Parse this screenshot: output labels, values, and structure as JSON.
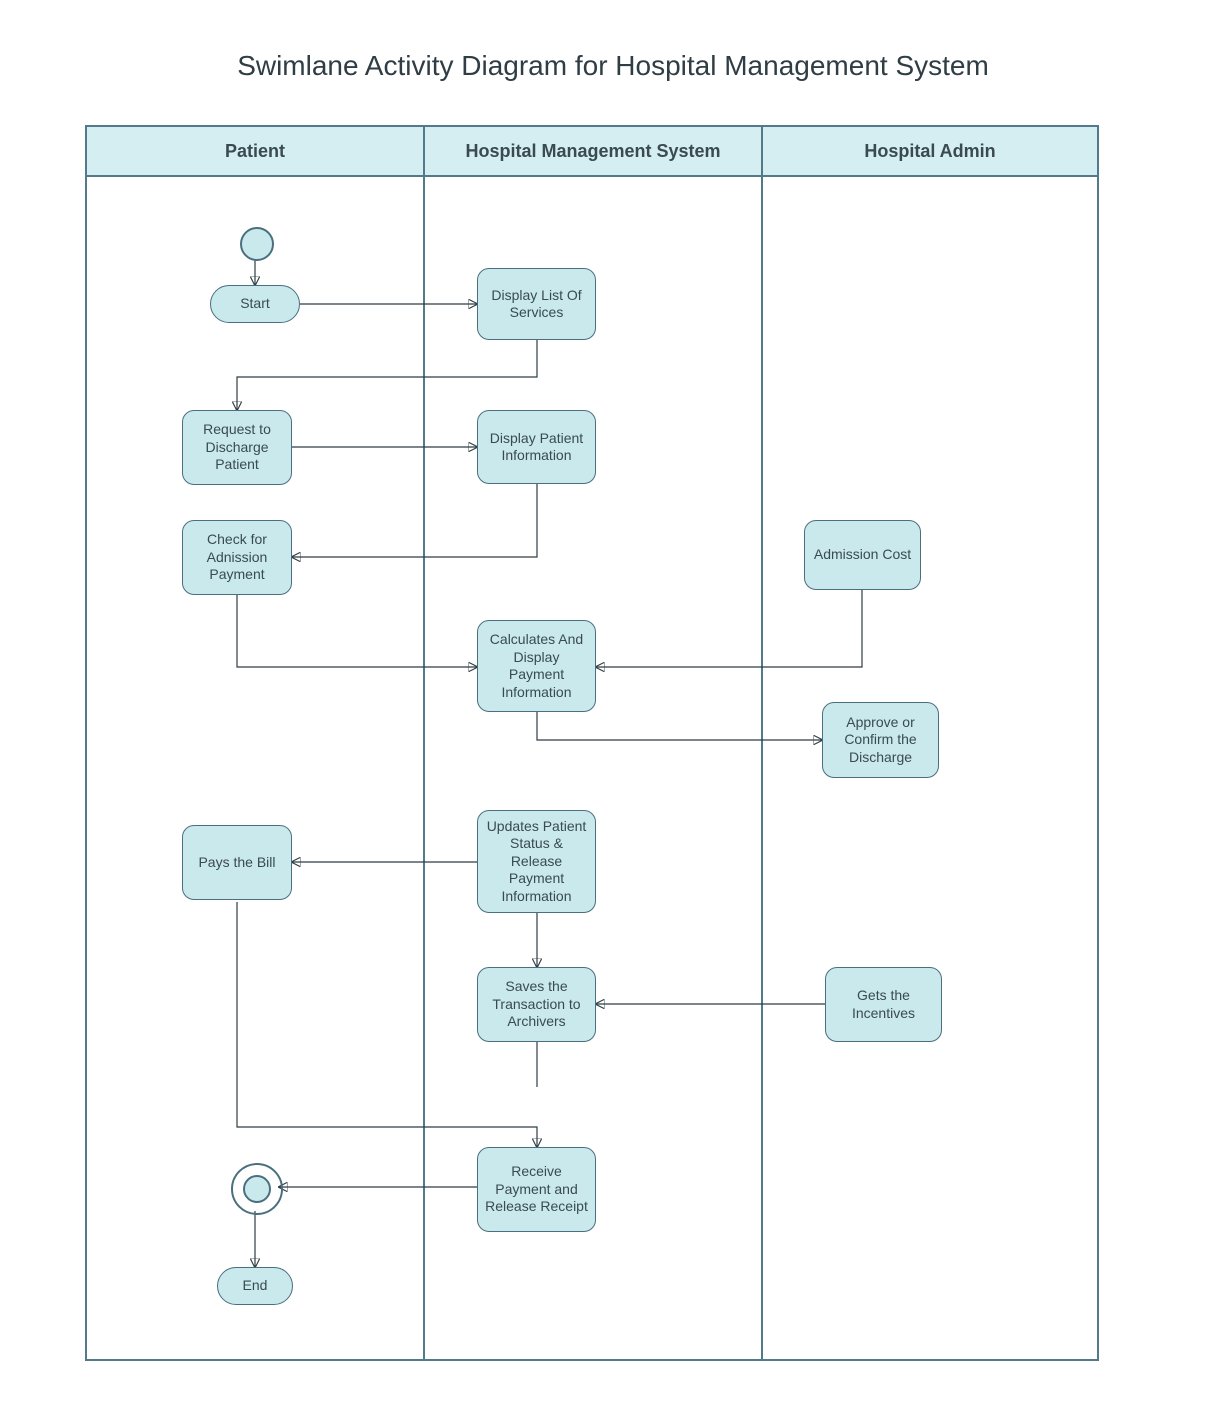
{
  "title": "Swimlane Activity Diagram for Hospital Management System",
  "lanes": {
    "patient": "Patient",
    "hms": "Hospital Management System",
    "admin": "Hospital Admin"
  },
  "nodes": {
    "start": "Start",
    "display_services": "Display List Of Services",
    "request_discharge": "Request to Discharge Patient",
    "display_patient_info": "Display Patient Information",
    "check_admission_payment": "Check for Adnission Payment",
    "admission_cost": "Admission Cost",
    "calc_payment": "Calculates And Display Payment Information",
    "approve_discharge": "Approve or Confirm the Discharge",
    "pays_bill": "Pays the Bill",
    "update_status": "Updates Patient Status & Release Payment Information",
    "saves_transaction": "Saves the Transaction to Archivers",
    "gets_incentives": "Gets the Incentives",
    "receive_payment": "Receive Payment and Release Receipt",
    "end": "End"
  },
  "colors": {
    "lane_header_bg": "#d5eef1",
    "node_bg": "#c9e9ec",
    "border": "#527a8a"
  }
}
